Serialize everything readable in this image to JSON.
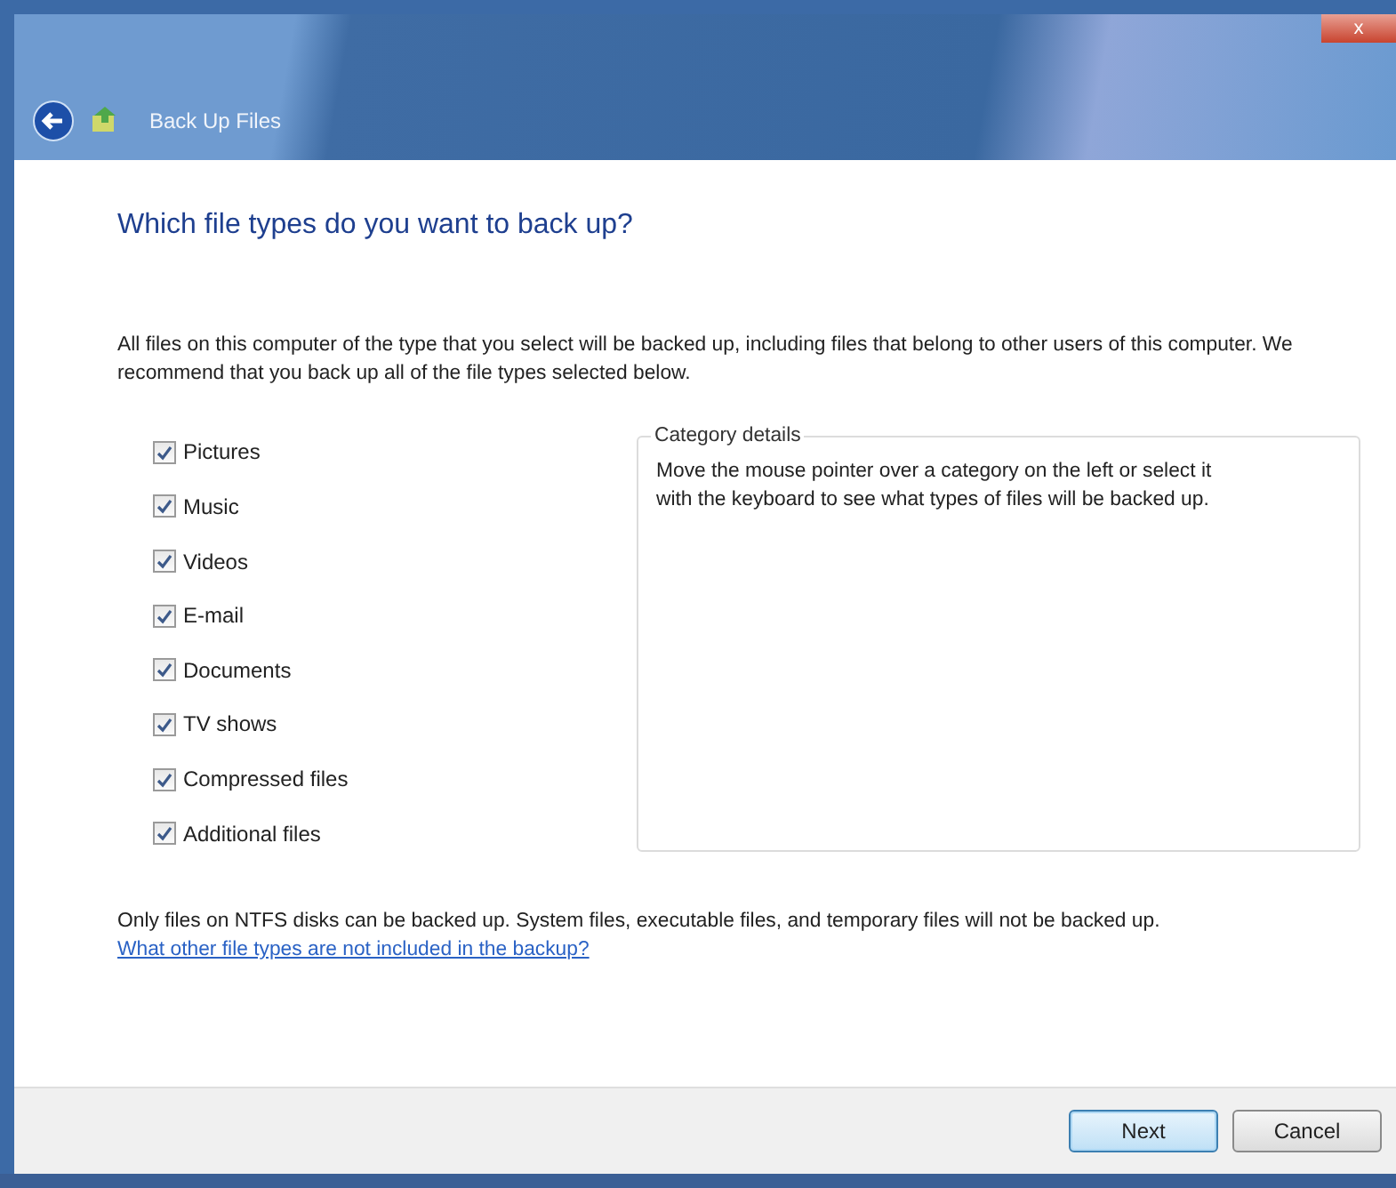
{
  "window": {
    "title": "Back Up Files",
    "close_icon": "x"
  },
  "heading": "Which file types do you want to back up?",
  "intro": "All files on this computer of the type that you select will be backed up, including files that belong to other users of this computer. We recommend that you back up all of the file types selected below.",
  "file_types": [
    {
      "label": "Pictures",
      "checked": true
    },
    {
      "label": "Music",
      "checked": true
    },
    {
      "label": "Videos",
      "checked": true
    },
    {
      "label": "E-mail",
      "checked": true
    },
    {
      "label": "Documents",
      "checked": true
    },
    {
      "label": "TV shows",
      "checked": true
    },
    {
      "label": "Compressed files",
      "checked": true
    },
    {
      "label": "Additional files",
      "checked": true
    }
  ],
  "category_details": {
    "title": "Category details",
    "text": "Move the mouse pointer over a category on the left or select it with the keyboard to see what types of files will be backed up."
  },
  "note": {
    "text": "Only files on NTFS disks can be backed up. System files, executable files, and temporary files will not be backed up.",
    "link": "What other file types are not included in the backup?"
  },
  "buttons": [
    {
      "label": "Next",
      "default": true
    },
    {
      "label": "Cancel",
      "default": false
    }
  ]
}
